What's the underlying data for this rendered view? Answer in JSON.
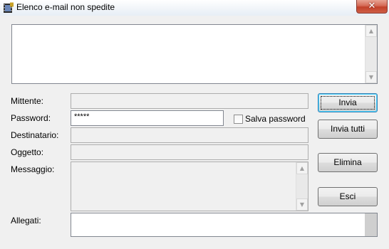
{
  "window": {
    "title": "Elenco e-mail non spedite",
    "close_glyph": "✕"
  },
  "icons": {
    "app": "film-strip-icon",
    "close": "close-icon",
    "scroll_up": "chevron-up-icon",
    "scroll_down": "chevron-down-icon"
  },
  "arrows": {
    "up": "▲",
    "down": "▼"
  },
  "form": {
    "mittente": {
      "label": "Mittente:",
      "value": ""
    },
    "password": {
      "label": "Password:",
      "value": "*****"
    },
    "salva_password": {
      "label": "Salva password",
      "checked": false
    },
    "destinatario": {
      "label": "Destinatario:",
      "value": ""
    },
    "oggetto": {
      "label": "Oggetto:",
      "value": ""
    },
    "messaggio": {
      "label": "Messaggio:",
      "value": ""
    },
    "allegati": {
      "label": "Allegati:",
      "value": ""
    }
  },
  "buttons": {
    "invia": "Invia",
    "invia_tutti": "Invia tutti",
    "elimina": "Elimina",
    "esci": "Esci"
  },
  "colors": {
    "close_button": "#c2412a",
    "default_button_border": "#3c7fb1",
    "window_background": "#f0f0f0"
  }
}
